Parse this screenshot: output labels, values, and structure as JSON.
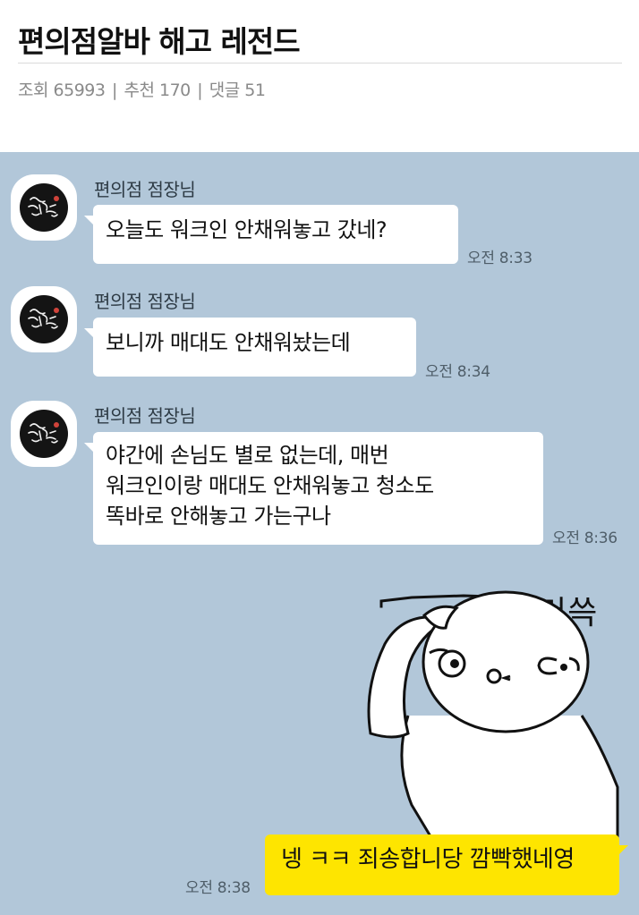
{
  "post": {
    "title": "편의점알바 해고 레전드",
    "meta": {
      "views_label": "조회",
      "views": "65993",
      "recommend_label": "추천",
      "recommend": "170",
      "comments_label": "댓글",
      "comments": "51"
    }
  },
  "chat": {
    "colors": {
      "background": "#b2c7d9",
      "bubble_in": "#ffffff",
      "bubble_out": "#fee500"
    },
    "messages": [
      {
        "sender": "편의점 점장님",
        "lines": [
          "오늘도 워크인 안채워놓고 갔네?"
        ],
        "time": "오전 8:33"
      },
      {
        "sender": "편의점 점장님",
        "lines": [
          "보니까 매대도 안채워놨는데"
        ],
        "time": "오전 8:34"
      },
      {
        "sender": "편의점 점장님",
        "lines": [
          "야간에 손님도 별로 없는데, 매번",
          "워크인이랑 매대도 안채워놓고 청소도",
          "똑바로 안해놓고 가는구나"
        ],
        "time": "오전 8:36"
      }
    ],
    "sticker": {
      "text": "머쓱",
      "icon": "embarrassed-head-scratch-sticker"
    },
    "reply": {
      "text": "넹 ㅋㅋ 죄송합니당 깜빡했네영",
      "time": "오전 8:38"
    }
  }
}
